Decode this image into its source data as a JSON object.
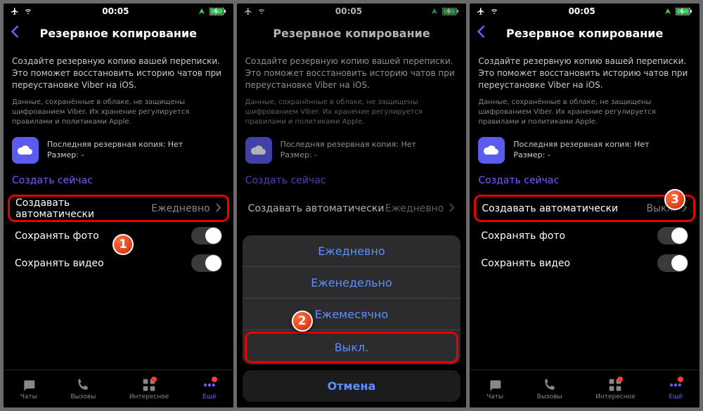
{
  "status": {
    "time": "00:05"
  },
  "header": {
    "title": "Резервное копирование"
  },
  "body": {
    "desc1": "Создайте резервную копию вашей переписки. Это поможет восстановить историю чатов при переустановке Viber на iOS.",
    "desc2": "Данные, сохранённые в облаке, не защищены шифрованием Viber. Их хранение регулируется правилами и политиками Apple.",
    "lastBackup": "Последняя резервная копия: Нет",
    "size": "Размер: -",
    "createNow": "Создать сейчас",
    "autoLabel": "Создавать автоматически",
    "autoValue1": "Ежедневно",
    "autoValue3": "Выкл.",
    "savePhoto": "Сохранять фото",
    "saveVideo": "Сохранять видео"
  },
  "sheet": {
    "daily": "Ежедневно",
    "weekly": "Еженедельно",
    "monthly": "Ежемесячно",
    "off": "Выкл.",
    "cancel": "Отмена"
  },
  "tabs": {
    "chats": "Чаты",
    "calls": "Вызовы",
    "interesting": "Интересное",
    "more": "Ещё"
  },
  "markers": {
    "m1": "1",
    "m2": "2",
    "m3": "3"
  }
}
